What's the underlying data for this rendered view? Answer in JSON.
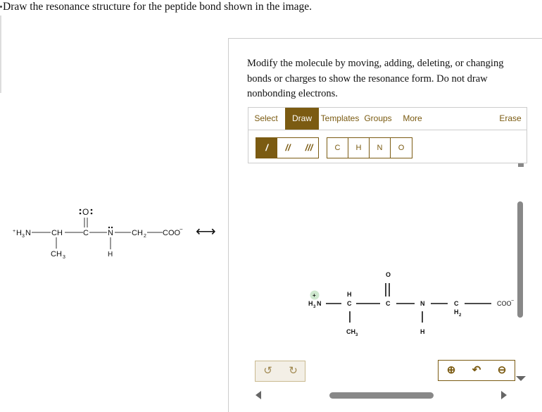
{
  "question": "Draw the resonance structure for the peptide bond shown in the image.",
  "instructions": "Modify the molecule by moving, adding, deleting, or changing bonds or charges to show the resonance form. Do not draw nonbonding electrons.",
  "tabs": [
    {
      "label": "Select"
    },
    {
      "label": "Draw"
    },
    {
      "label": "Templates"
    },
    {
      "label": "Groups"
    },
    {
      "label": "More"
    },
    {
      "label": "Erase"
    }
  ],
  "bond_buttons": [
    "/",
    "//",
    "///"
  ],
  "atom_buttons": [
    "C",
    "H",
    "N",
    "O"
  ],
  "left_structure": {
    "nh3": "H",
    "nh3_sub": "3",
    "nh3_n": "N",
    "plus": "+",
    "ch": "CH",
    "c": "C",
    "o": "O",
    "n": "N",
    "ch2": "CH",
    "ch2_sub": "2",
    "coo": "COO",
    "minus": "−",
    "ch3": "CH",
    "ch3_sub": "3",
    "h": "H",
    "arrow": "⟷"
  },
  "canvas_structure": {
    "plus": "+",
    "h3n": "H",
    "h3n_sub": "3",
    "h3n_n": "N",
    "h_top": "H",
    "c1": "C",
    "ch3": "CH",
    "ch3_sub": "3",
    "o": "O",
    "c2": "C",
    "n": "N",
    "h": "H",
    "c3": "C",
    "h2": "H",
    "h2_sub": "2",
    "coo": "COO",
    "minus": "−"
  },
  "undo_icons": [
    "undo-icon",
    "redo-icon"
  ],
  "zoom_icons": [
    "zoom-in-icon",
    "reset-zoom-icon",
    "zoom-out-icon"
  ],
  "colors": {
    "accent": "#7b5b12",
    "plus_badge": "#cfe8cf"
  }
}
